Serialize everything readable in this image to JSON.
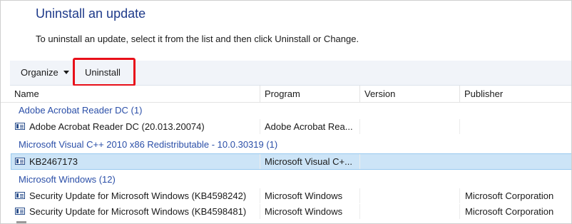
{
  "page": {
    "title": "Uninstall an update",
    "subtitle": "To uninstall an update, select it from the list and then click Uninstall or Change."
  },
  "toolbar": {
    "organize_label": "Organize",
    "uninstall_label": "Uninstall"
  },
  "columns": [
    "Name",
    "Program",
    "Version",
    "Publisher"
  ],
  "groups": [
    {
      "label": "Adobe Acrobat Reader DC (1)"
    },
    {
      "label": "Microsoft Visual C++ 2010  x86 Redistributable - 10.0.30319 (1)"
    },
    {
      "label": "Microsoft Windows (12)"
    }
  ],
  "rows": [
    {
      "name": "Adobe Acrobat Reader DC  (20.013.20074)",
      "program": "Adobe Acrobat Rea...",
      "version": "",
      "publisher": "",
      "selected": false
    },
    {
      "name": "KB2467173",
      "program": "Microsoft Visual C+...",
      "version": "",
      "publisher": "",
      "selected": true
    },
    {
      "name": "Security Update for Microsoft Windows (KB4598242)",
      "program": "Microsoft Windows",
      "version": "",
      "publisher": "Microsoft Corporation",
      "selected": false
    },
    {
      "name": "Security Update for Microsoft Windows (KB4598481)",
      "program": "Microsoft Windows",
      "version": "",
      "publisher": "Microsoft Corporation",
      "selected": false
    }
  ],
  "colors": {
    "title": "#1e3a8a",
    "group": "#2b4fa8",
    "selection": "#cce4f7",
    "highlight": "#e8101a"
  }
}
